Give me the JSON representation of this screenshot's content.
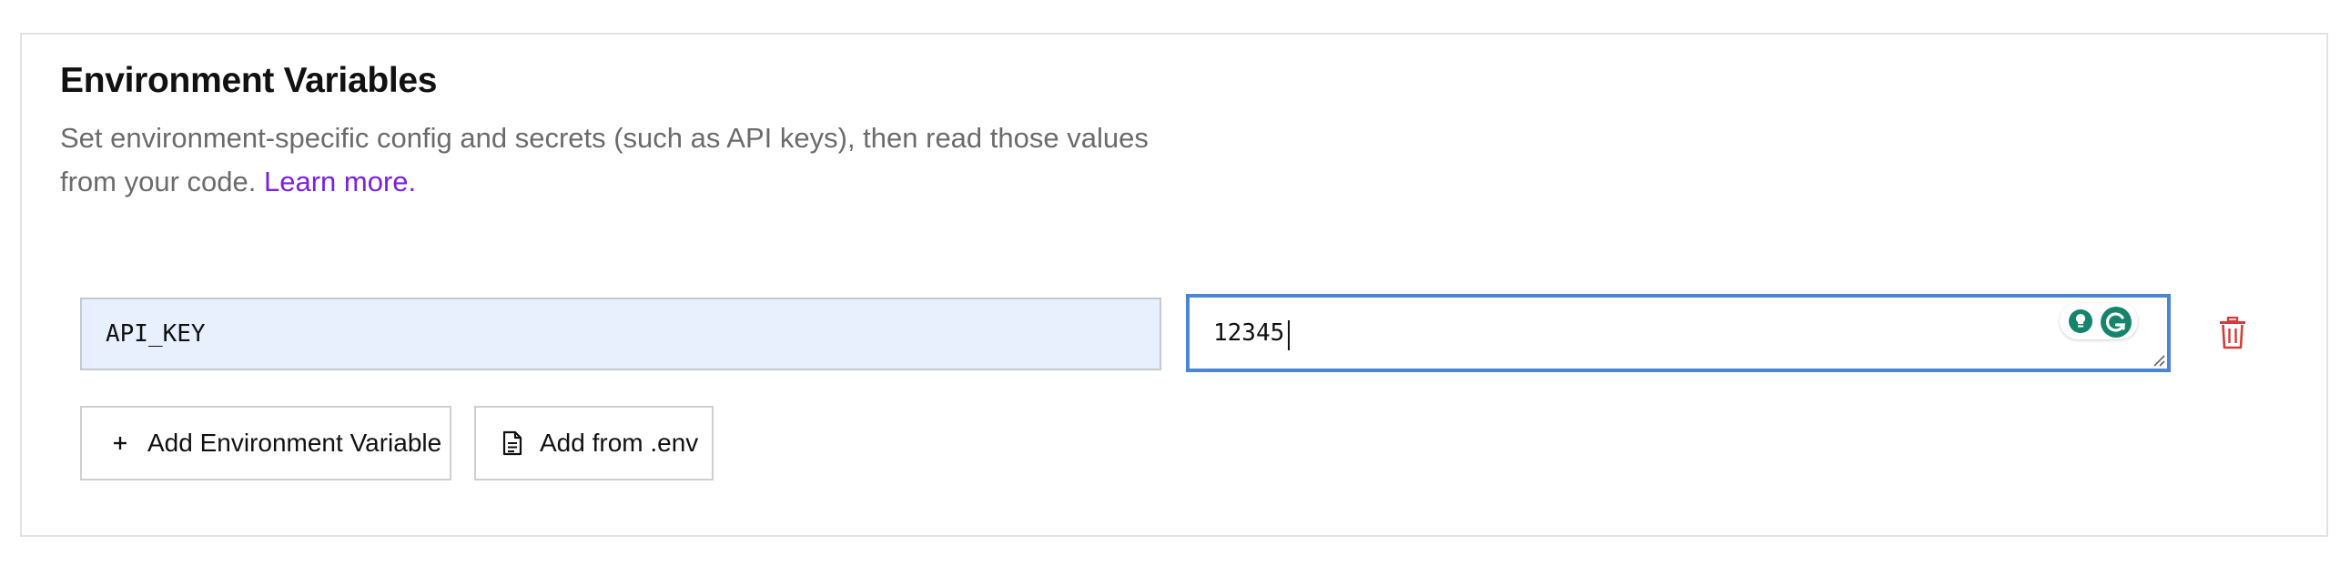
{
  "section": {
    "title": "Environment Variables",
    "description": "Set environment-specific config and secrets (such as API keys), then read those values from your code.",
    "learn_more": "Learn more."
  },
  "env_vars": [
    {
      "key": "API_KEY",
      "value": "12345"
    }
  ],
  "actions": {
    "add_variable": "Add Environment Variable",
    "add_from_env": "Add from .env"
  },
  "icons": {
    "add": "plus-icon",
    "file": "file-icon",
    "delete": "trash-icon",
    "extension_bulb": "bulb-icon",
    "extension_grammarly": "grammarly-icon"
  },
  "colors": {
    "link": "#7b1fe0",
    "focus_border": "#4a86d4",
    "autofill_bg": "#e8f0fe",
    "delete": "#d23c3c",
    "grammarly": "#15846b"
  }
}
